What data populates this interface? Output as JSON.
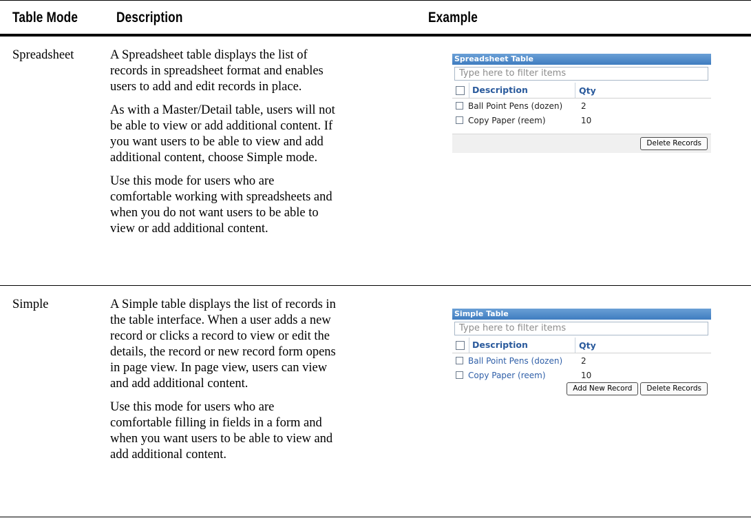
{
  "headers": {
    "mode": "Table Mode",
    "description": "Description",
    "example": "Example"
  },
  "rows": [
    {
      "mode": "Spreadsheet",
      "paragraphs": [
        "A Spreadsheet table displays the list of records in spreadsheet format and enables users to add and edit records in place.",
        "As with a Master/Detail table, users will not be able to view or add additional content. If you want users to be able to view and add additional content, choose Simple mode.",
        "Use this mode for users who are comfortable working with spreadsheets and when you do not want users to be able to view or add additional content."
      ],
      "widget": {
        "title": "Spreadsheet Table",
        "filter_placeholder": "Type here to filter items",
        "col_description": "Description",
        "col_qty": "Qty",
        "items": [
          {
            "description": "Ball Point Pens (dozen)",
            "qty": "2"
          },
          {
            "description": "Copy Paper (reem)",
            "qty": "10"
          }
        ],
        "delete_label": "Delete Records"
      }
    },
    {
      "mode": "Simple",
      "paragraphs": [
        "A Simple table displays the list of records in the table interface. When a user adds a new record or clicks a record to view or edit the details, the record or new record form opens in page view. In page view, users can view and add additional content.",
        "Use this mode for users who are comfortable filling in fields in a form and when you want users to be able to view and add additional content."
      ],
      "widget": {
        "title": "Simple Table",
        "filter_placeholder": "Type here to filter items",
        "col_description": "Description",
        "col_qty": "Qty",
        "items": [
          {
            "description": "Ball Point Pens (dozen)",
            "qty": "2"
          },
          {
            "description": "Copy Paper (reem)",
            "qty": "10"
          }
        ],
        "add_label": "Add New Record",
        "delete_label": "Delete Records"
      }
    }
  ]
}
